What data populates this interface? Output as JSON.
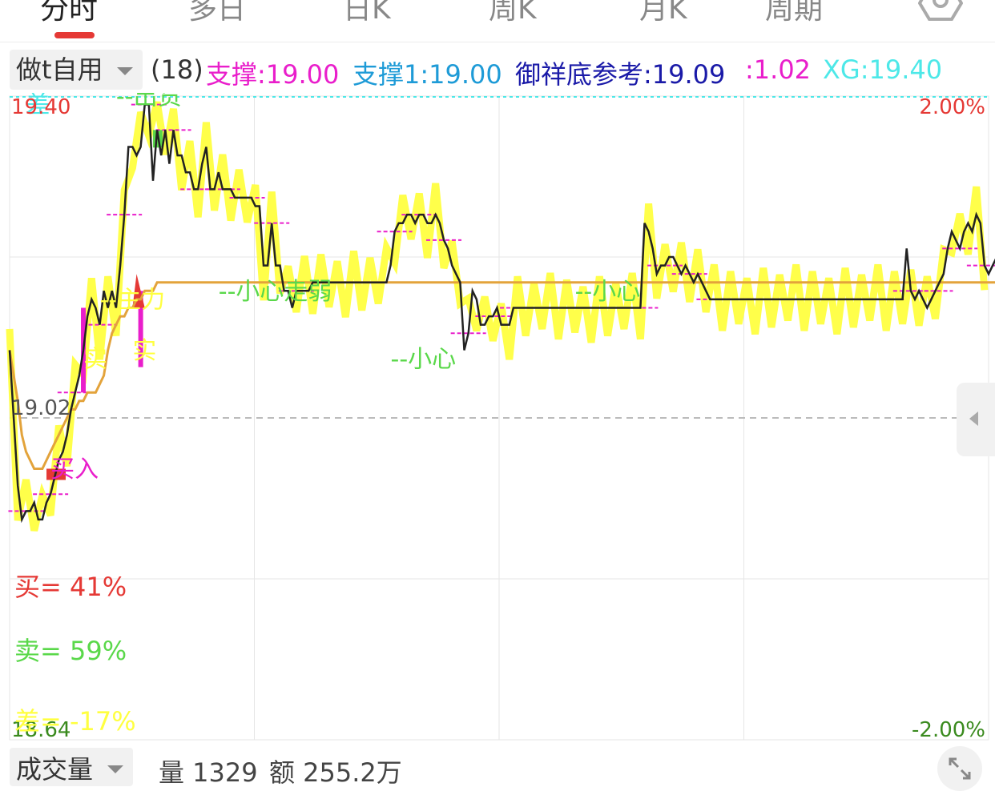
{
  "tabs": [
    {
      "label": "分时",
      "active": true
    },
    {
      "label": "多日",
      "active": false
    },
    {
      "label": "日K",
      "active": false
    },
    {
      "label": "周K",
      "active": false
    },
    {
      "label": "月K",
      "active": false
    },
    {
      "label": "周期",
      "active": false
    }
  ],
  "indicator_bar": {
    "selector_label": "做t自用",
    "items": [
      {
        "text": "(18)",
        "color": "#333333"
      },
      {
        "text": "支撑:19.00",
        "color": "#e91ecb"
      },
      {
        "text": "支撑1:19.00",
        "color": "#1e9bd7"
      },
      {
        "text": "御祥底参考:19.09",
        "color": "#1a1aa8"
      },
      {
        "text": ":1.02",
        "color": "#e91ecb"
      },
      {
        "text": "XG:19.40",
        "color": "#4de8e8"
      }
    ]
  },
  "colors": {
    "price_line": "#222222",
    "avg_line": "#e3a33b",
    "yellow_band": "#ffff40",
    "green_label": "#5ad84a",
    "red": "#e53935",
    "magenta": "#e91ecb",
    "cyan_dash": "#4de8e8",
    "grid": "#e6e6e6"
  },
  "chart_data": {
    "type": "line",
    "ylim": [
      18.64,
      19.4
    ],
    "reference_price": 19.02,
    "price_labels": {
      "top": "19.40",
      "mid": "19.02",
      "bottom": "18.64"
    },
    "pct_labels": {
      "top": "2.00%",
      "bottom": "-2.00%"
    },
    "price_points": 240,
    "series": [
      {
        "name": "",
        "values": [
          19.1,
          19.02,
          18.94,
          18.9,
          18.91,
          18.91,
          18.92,
          18.9,
          18.9,
          18.92,
          18.93,
          18.95,
          18.97,
          18.98,
          19.0,
          19.03,
          19.05,
          19.07,
          19.1,
          19.14,
          19.16,
          19.15,
          19.13,
          19.17,
          19.15,
          19.17,
          19.15,
          19.2,
          19.26,
          19.34,
          19.34,
          19.33,
          19.34,
          19.39,
          19.39,
          19.3,
          19.36,
          19.33,
          19.36,
          19.32,
          19.36,
          19.33,
          19.33,
          19.31,
          19.31,
          19.29,
          19.29,
          19.32,
          19.34,
          19.29,
          19.29,
          19.31,
          19.29,
          19.29,
          19.29,
          19.28,
          19.28,
          19.28,
          19.28,
          19.28,
          19.27,
          19.27,
          19.2,
          19.2,
          19.25,
          19.2,
          19.2,
          19.17,
          19.17,
          19.15,
          19.17,
          19.17,
          19.17,
          19.17,
          19.18,
          19.18,
          19.18,
          19.18,
          19.18,
          19.18,
          19.18,
          19.18,
          19.18,
          19.18,
          19.18,
          19.18,
          19.18,
          19.18,
          19.18,
          19.18,
          19.18,
          19.18,
          19.18,
          19.2,
          19.24,
          19.25,
          19.25,
          19.26,
          19.26,
          19.25,
          19.26,
          19.26,
          19.25,
          19.25,
          19.26,
          19.25,
          19.23,
          19.22,
          19.2,
          19.19,
          19.18,
          19.1,
          19.12,
          19.17,
          19.16,
          19.13,
          19.13,
          19.14,
          19.14,
          19.15,
          19.13,
          19.13,
          19.13,
          19.15,
          19.15,
          19.15,
          19.15,
          19.15,
          19.15,
          19.15,
          19.15,
          19.15,
          19.15,
          19.15,
          19.15,
          19.15,
          19.15,
          19.15,
          19.15,
          19.15,
          19.15,
          19.15,
          19.15,
          19.15,
          19.15,
          19.15,
          19.15,
          19.15,
          19.15,
          19.15,
          19.15,
          19.15,
          19.15,
          19.15,
          19.15,
          19.25,
          19.24,
          19.22,
          19.19,
          19.2,
          19.2,
          19.21,
          19.21,
          19.2,
          19.19,
          19.2,
          19.19,
          19.18,
          19.19,
          19.18,
          19.17,
          19.16,
          19.16,
          19.16,
          19.16,
          19.16,
          19.16,
          19.16,
          19.16,
          19.16,
          19.16,
          19.16,
          19.16,
          19.16,
          19.16,
          19.16,
          19.16,
          19.16,
          19.16,
          19.16,
          19.16,
          19.16,
          19.16,
          19.16,
          19.16,
          19.16,
          19.16,
          19.16,
          19.16,
          19.16,
          19.16,
          19.16,
          19.16,
          19.16,
          19.16,
          19.16,
          19.16,
          19.16,
          19.16,
          19.16,
          19.16,
          19.16,
          19.16,
          19.16,
          19.16,
          19.16,
          19.16,
          19.16,
          19.16,
          19.22,
          19.17,
          19.16,
          19.17,
          19.16,
          19.15,
          19.16,
          19.17,
          19.18,
          19.19,
          19.22,
          19.24,
          19.23,
          19.22,
          19.24,
          19.25,
          19.24,
          19.26,
          19.25,
          19.2,
          19.19,
          19.2,
          19.21,
          19.21,
          19.2,
          19.21,
          19.21,
          19.2,
          19.2,
          19.2,
          19.2,
          19.19,
          19.19,
          19.18,
          19.18,
          19.18,
          19.18
        ]
      },
      {
        "name": "",
        "values": [
          19.1,
          19.07,
          19.04,
          19.0,
          18.98,
          18.97,
          18.96,
          18.96,
          18.96,
          18.97,
          18.98,
          18.99,
          19.0,
          19.01,
          19.02,
          19.03,
          19.03,
          19.04,
          19.04,
          19.05,
          19.05,
          19.05,
          19.06,
          19.07,
          19.1,
          19.12,
          19.13,
          19.14,
          19.14,
          19.15,
          19.15,
          19.16,
          19.16,
          19.17,
          19.17,
          19.17,
          19.18,
          19.18,
          19.18,
          19.18,
          19.18,
          19.18,
          19.18,
          19.18,
          19.18,
          19.18,
          19.18,
          19.18,
          19.18,
          19.18,
          19.18,
          19.18,
          19.18,
          19.18,
          19.18,
          19.18,
          19.18,
          19.18,
          19.18,
          19.18,
          19.18,
          19.18,
          19.18,
          19.18,
          19.18,
          19.18,
          19.18,
          19.18,
          19.18,
          19.18,
          19.18,
          19.18,
          19.18,
          19.18,
          19.18,
          19.18,
          19.18,
          19.18,
          19.18,
          19.18,
          19.18,
          19.18,
          19.18,
          19.18,
          19.18,
          19.18,
          19.18,
          19.18,
          19.18,
          19.18,
          19.18,
          19.18,
          19.18,
          19.18,
          19.18,
          19.18,
          19.18,
          19.18,
          19.18,
          19.18,
          19.18,
          19.18,
          19.18,
          19.18,
          19.18,
          19.18,
          19.18,
          19.18,
          19.18,
          19.18,
          19.18,
          19.18,
          19.18,
          19.18,
          19.18,
          19.18,
          19.18,
          19.18,
          19.18,
          19.18,
          19.18,
          19.18,
          19.18,
          19.18,
          19.18,
          19.18,
          19.18,
          19.18,
          19.18,
          19.18,
          19.18,
          19.18,
          19.18,
          19.18,
          19.18,
          19.18,
          19.18,
          19.18,
          19.18,
          19.18,
          19.18,
          19.18,
          19.18,
          19.18,
          19.18,
          19.18,
          19.18,
          19.18,
          19.18,
          19.18,
          19.18,
          19.18,
          19.18,
          19.18,
          19.18,
          19.18,
          19.18,
          19.18,
          19.18,
          19.18,
          19.18,
          19.18,
          19.18,
          19.18,
          19.18,
          19.18,
          19.18,
          19.18,
          19.18,
          19.18,
          19.18,
          19.18,
          19.18,
          19.18,
          19.18,
          19.18,
          19.18,
          19.18,
          19.18,
          19.18,
          19.18,
          19.18,
          19.18,
          19.18,
          19.18,
          19.18,
          19.18,
          19.18,
          19.18,
          19.18,
          19.18,
          19.18,
          19.18,
          19.18,
          19.18,
          19.18,
          19.18,
          19.18,
          19.18,
          19.18,
          19.18,
          19.18,
          19.18,
          19.18,
          19.18,
          19.18,
          19.18,
          19.18,
          19.18,
          19.18,
          19.18,
          19.18,
          19.18,
          19.18,
          19.18,
          19.18,
          19.18,
          19.18,
          19.18,
          19.18,
          19.18,
          19.18,
          19.18,
          19.18,
          19.18,
          19.18,
          19.18,
          19.18,
          19.18,
          19.18,
          19.18,
          19.18,
          19.18,
          19.18,
          19.18,
          19.18,
          19.18,
          19.18,
          19.18,
          19.18,
          19.18,
          19.18,
          19.18,
          19.18
        ]
      }
    ],
    "annotations": [
      {
        "text": "--出货",
        "color": "#5ad84a",
        "index": 26,
        "value": 19.39
      },
      {
        "text": "差",
        "color": "#4de8e8",
        "index": 4,
        "value": 19.38
      },
      {
        "text": "--主力",
        "color": "#ffff40",
        "index": 22,
        "value": 19.15
      },
      {
        "text": "实",
        "color": "#ffff40",
        "index": 18,
        "value": 19.08
      },
      {
        "text": "实",
        "color": "#ffff40",
        "index": 30,
        "value": 19.09
      },
      {
        "text": "买入",
        "color": "#e91ecb",
        "index": 10,
        "value": 18.95
      },
      {
        "text": "--小心走弱",
        "color": "#5ad84a",
        "index": 51,
        "value": 19.16
      },
      {
        "text": "--小心",
        "color": "#5ad84a",
        "index": 93,
        "value": 19.08
      },
      {
        "text": "--小心",
        "color": "#5ad84a",
        "index": 138,
        "value": 19.16
      }
    ],
    "stats": [
      {
        "label": "买=",
        "value": "41%",
        "color": "#e53935"
      },
      {
        "label": "卖=",
        "value": "59%",
        "color": "#5ad84a"
      },
      {
        "label": "差=",
        "value": "-17%",
        "color": "#ffff40"
      }
    ]
  },
  "volume_bar": {
    "selector_label": "成交量",
    "volume": "量 1329",
    "amount": "额 255.2万"
  }
}
